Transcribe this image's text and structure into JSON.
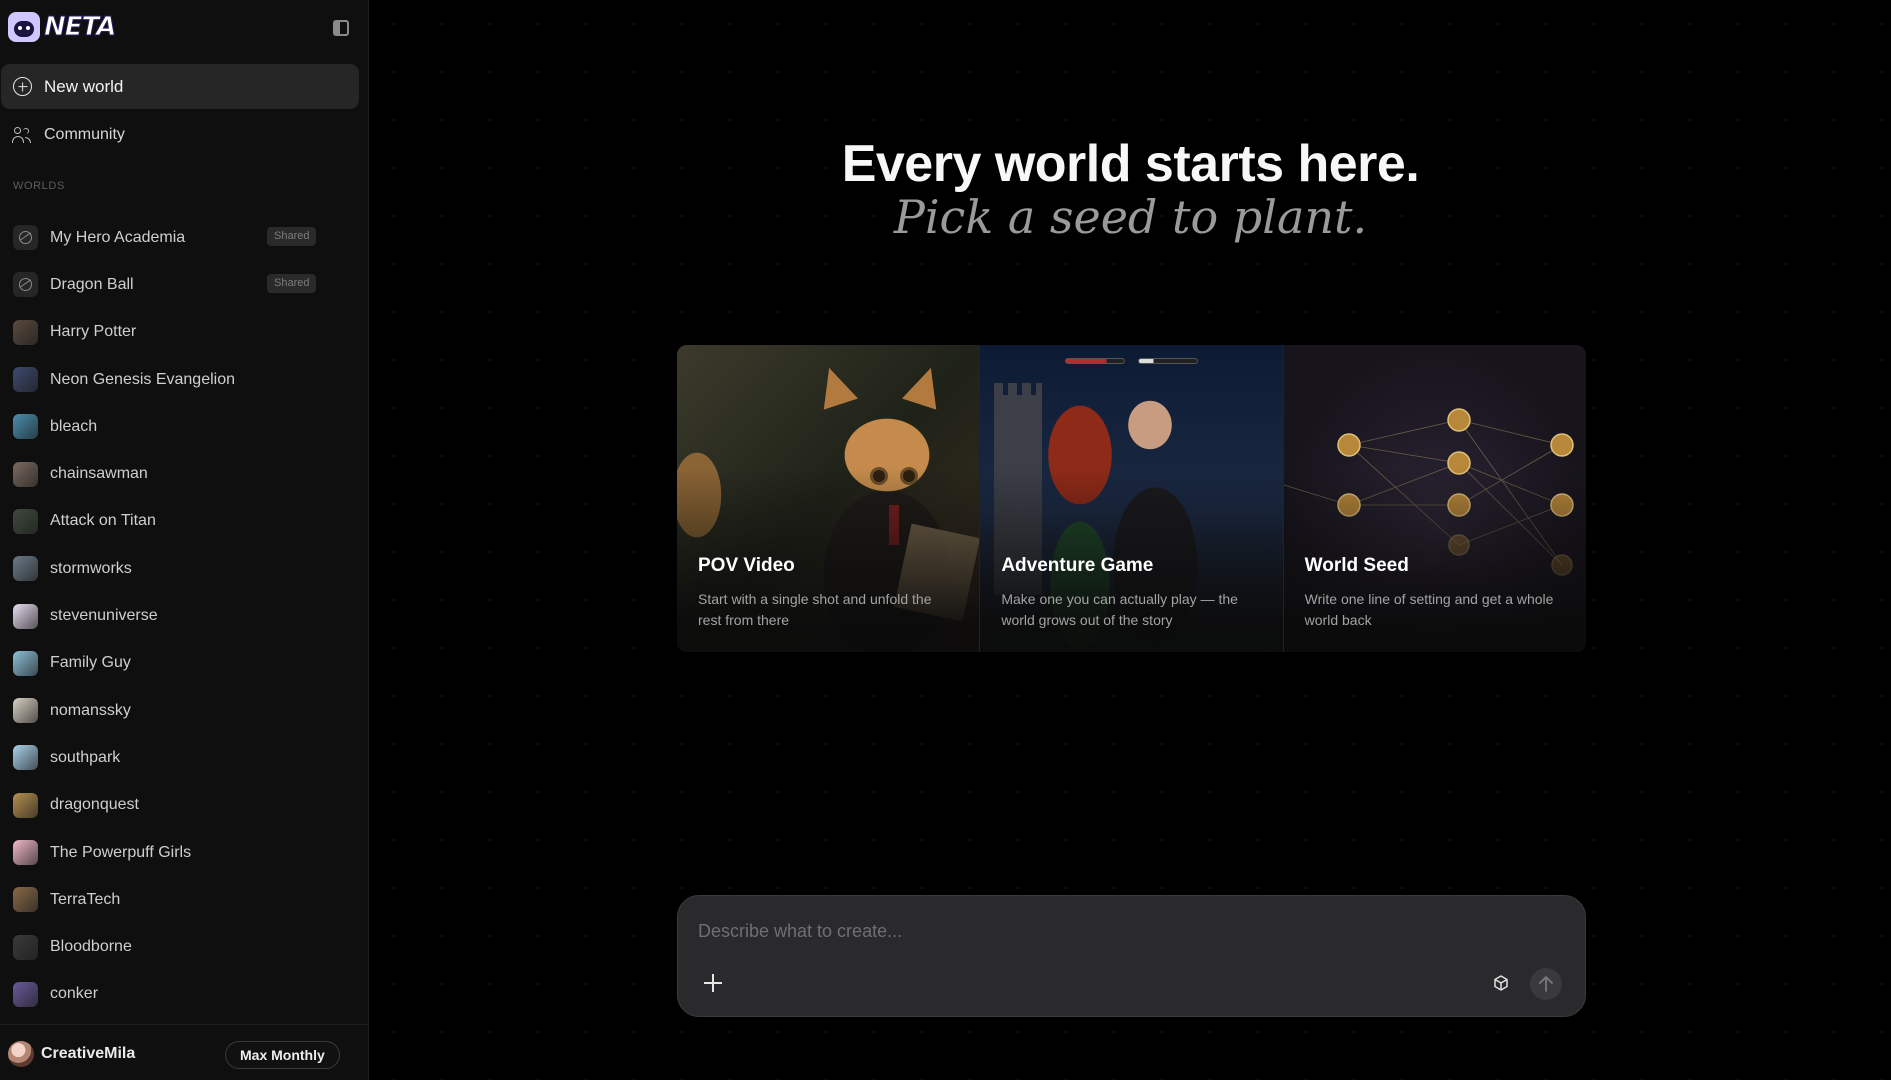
{
  "app": {
    "name": "NETA"
  },
  "sidebar": {
    "new_world_label": "New world",
    "community_label": "Community",
    "section_label": "WORLDS",
    "worlds": [
      {
        "name": "My Hero Academia",
        "badge": "Shared",
        "thumb": "globe-icon"
      },
      {
        "name": "Dragon Ball",
        "badge": "Shared",
        "thumb": "globe-icon"
      },
      {
        "name": "Harry Potter",
        "badge": "",
        "thumb": "#5a4a3e"
      },
      {
        "name": "Neon Genesis Evangelion",
        "badge": "",
        "thumb": "#3d4a6e"
      },
      {
        "name": "bleach",
        "badge": "",
        "thumb": "#4a8fb0"
      },
      {
        "name": "chainsawman",
        "badge": "",
        "thumb": "#7a6a60"
      },
      {
        "name": "Attack on Titan",
        "badge": "",
        "thumb": "#3e4a3c"
      },
      {
        "name": "stormworks",
        "badge": "",
        "thumb": "#6a7a88"
      },
      {
        "name": "stevenuniverse",
        "badge": "",
        "thumb": "#e8dcef"
      },
      {
        "name": "Family Guy",
        "badge": "",
        "thumb": "#8cc0d8"
      },
      {
        "name": "nomanssky",
        "badge": "",
        "thumb": "#d8d0c4"
      },
      {
        "name": "southpark",
        "badge": "",
        "thumb": "#a9d2ec"
      },
      {
        "name": "dragonquest",
        "badge": "",
        "thumb": "#b7904e"
      },
      {
        "name": "The Powerpuff Girls",
        "badge": "",
        "thumb": "#f0b8c8"
      },
      {
        "name": "TerraTech",
        "badge": "",
        "thumb": "#8a6a48"
      },
      {
        "name": "Bloodborne",
        "badge": "",
        "thumb": "#3a3a3a"
      },
      {
        "name": "conker",
        "badge": "",
        "thumb": "#6a5a9a"
      }
    ],
    "user": {
      "name": "CreativeMila",
      "plan_label": "Max Monthly"
    }
  },
  "main": {
    "title": "Every world starts here.",
    "subtitle": "Pick a seed to plant.",
    "cards": [
      {
        "title": "POV Video",
        "description": "Start with a single shot and unfold the rest from there"
      },
      {
        "title": "Adventure Game",
        "description": "Make one you can actually play — the world grows out of the story"
      },
      {
        "title": "World Seed",
        "description": "Write one line of setting and get a whole world back"
      }
    ],
    "composer": {
      "placeholder": "Describe what to create..."
    }
  },
  "colors": {
    "background": "#000000",
    "sidebar": "#0f0f0f",
    "accent_selected": "#262626",
    "composer": "#2a2a2c"
  }
}
